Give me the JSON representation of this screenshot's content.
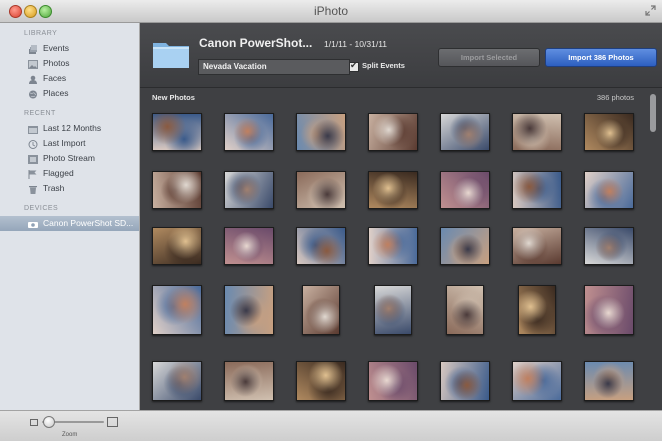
{
  "window": {
    "title": "iPhoto",
    "fullscreen_icon": "fullscreen-arrows-icon"
  },
  "sidebar": {
    "sections": [
      {
        "header": "LIBRARY",
        "items": [
          {
            "label": "Events",
            "icon": "events-icon"
          },
          {
            "label": "Photos",
            "icon": "photos-icon"
          },
          {
            "label": "Faces",
            "icon": "faces-icon"
          },
          {
            "label": "Places",
            "icon": "places-icon"
          }
        ]
      },
      {
        "header": "RECENT",
        "items": [
          {
            "label": "Last 12 Months",
            "icon": "calendar-icon"
          },
          {
            "label": "Last Import",
            "icon": "clock-icon"
          },
          {
            "label": "Photo Stream",
            "icon": "photo-stream-icon"
          },
          {
            "label": "Flagged",
            "icon": "flag-icon"
          },
          {
            "label": "Trash",
            "icon": "trash-icon"
          }
        ]
      },
      {
        "header": "DEVICES",
        "items": [
          {
            "label": "Canon PowerShot SD...",
            "icon": "camera-icon",
            "selected": true
          }
        ]
      }
    ]
  },
  "import": {
    "device_name": "Canon PowerShot...",
    "date_range": "1/1/11 - 10/31/11",
    "event_name": "Nevada Vacation",
    "split_events_label": "Split Events",
    "split_events_checked": true,
    "import_selected_label": "Import Selected",
    "import_all_label": "Import 386 Photos"
  },
  "photos": {
    "section_label": "New Photos",
    "count_label": "386 photos"
  },
  "bottom": {
    "zoom_label": "Zoom",
    "zoom_level": 0.05
  },
  "colors": {
    "accent_blue": "#2c5fc0",
    "sidebar_bg": "#dfe3e9",
    "main_bg": "#3f4043"
  }
}
